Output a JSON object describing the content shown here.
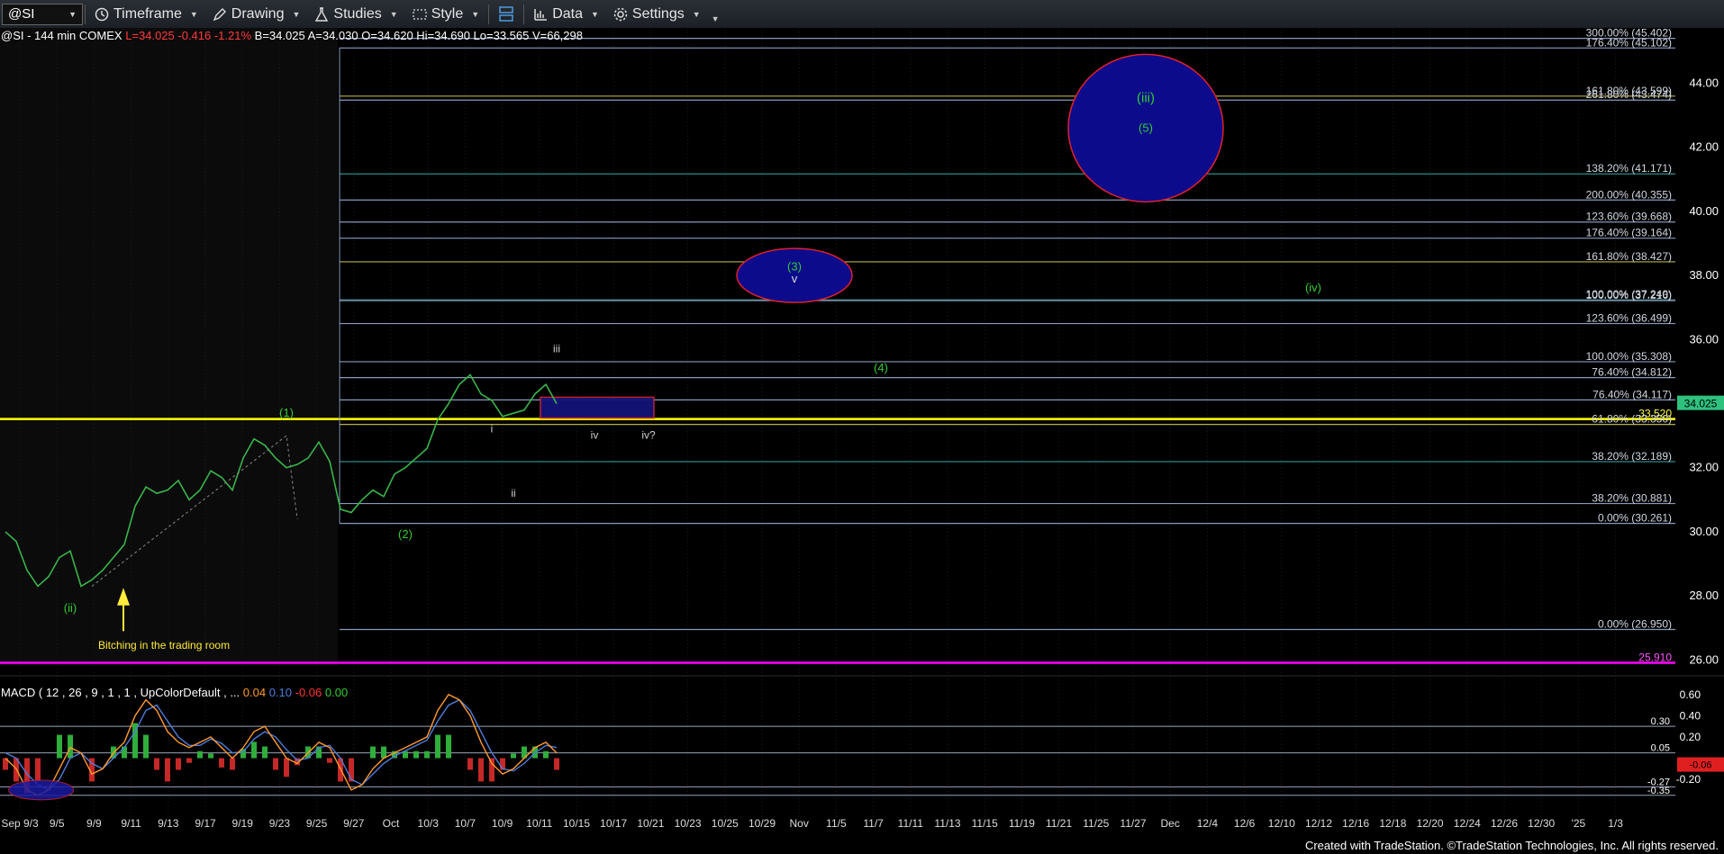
{
  "toolbar": {
    "symbol": "@SI",
    "items": [
      {
        "label": "Timeframe",
        "icon": "clock-icon"
      },
      {
        "label": "Drawing",
        "icon": "pencil-icon"
      },
      {
        "label": "Studies",
        "icon": "flask-icon"
      },
      {
        "label": "Style",
        "icon": "style-icon"
      },
      {
        "label": "",
        "icon": "layout-icon"
      },
      {
        "label": "Data",
        "icon": "bar-chart-icon"
      },
      {
        "label": "Settings",
        "icon": "gear-icon"
      }
    ]
  },
  "header": {
    "prefix": "@SI - 144 min  COMEX ",
    "last": "L=34.025 -0.416 -1.21%",
    "rest": " B=34.025  A=34.030  O=34.620  Hi=34.690  Lo=33.565  V=66,298"
  },
  "footer": "Created with TradeStation. ©TradeStation Technologies, Inc. All rights reserved.",
  "chart_data": {
    "type": "line",
    "title": "@SI - 144 min COMEX",
    "price_axis": {
      "ticks": [
        26.0,
        28.0,
        30.0,
        32.0,
        34.0,
        36.0,
        38.0,
        40.0,
        42.0,
        44.0
      ],
      "range": [
        25.7,
        45.7
      ],
      "last_price": "34.025"
    },
    "x_ticks": [
      "Sep 9/3",
      "9/5",
      "9/9",
      "9/11",
      "9/13",
      "9/17",
      "9/19",
      "9/23",
      "9/25",
      "9/27",
      "Oct",
      "10/3",
      "10/7",
      "10/9",
      "10/11",
      "10/15",
      "10/17",
      "10/21",
      "10/23",
      "10/25",
      "10/29",
      "Nov",
      "11/5",
      "11/7",
      "11/11",
      "11/13",
      "11/15",
      "11/19",
      "11/21",
      "11/25",
      "11/27",
      "Dec",
      "12/4",
      "12/6",
      "12/10",
      "12/12",
      "12/16",
      "12/18",
      "12/20",
      "12/24",
      "12/26",
      "12/30",
      "'25",
      "1/3"
    ],
    "price_path": [
      [
        0,
        30.0
      ],
      [
        1,
        29.7
      ],
      [
        2,
        28.8
      ],
      [
        3,
        28.3
      ],
      [
        4,
        28.6
      ],
      [
        5,
        29.2
      ],
      [
        6,
        29.4
      ],
      [
        7,
        28.3
      ],
      [
        8,
        28.5
      ],
      [
        9,
        28.8
      ],
      [
        10,
        29.2
      ],
      [
        11,
        29.6
      ],
      [
        12,
        30.8
      ],
      [
        13,
        31.4
      ],
      [
        14,
        31.2
      ],
      [
        15,
        31.3
      ],
      [
        16,
        31.6
      ],
      [
        17,
        31.0
      ],
      [
        18,
        31.3
      ],
      [
        19,
        31.9
      ],
      [
        20,
        31.7
      ],
      [
        21,
        31.3
      ],
      [
        22,
        32.3
      ],
      [
        23,
        32.9
      ],
      [
        24,
        32.7
      ],
      [
        25,
        32.3
      ],
      [
        26,
        32.0
      ],
      [
        27,
        32.1
      ],
      [
        28,
        32.3
      ],
      [
        29,
        32.8
      ],
      [
        30,
        32.2
      ],
      [
        31,
        30.7
      ],
      [
        32,
        30.6
      ],
      [
        33,
        31.0
      ],
      [
        34,
        31.3
      ],
      [
        35,
        31.1
      ],
      [
        36,
        31.8
      ],
      [
        37,
        32.0
      ],
      [
        38,
        32.3
      ],
      [
        39,
        32.6
      ],
      [
        40,
        33.5
      ],
      [
        41,
        34.0
      ],
      [
        42,
        34.6
      ],
      [
        43,
        34.9
      ],
      [
        44,
        34.3
      ],
      [
        45,
        34.1
      ],
      [
        46,
        33.6
      ],
      [
        47,
        33.7
      ],
      [
        48,
        33.8
      ],
      [
        49,
        34.3
      ],
      [
        50,
        34.6
      ],
      [
        51,
        34.0
      ]
    ],
    "hlines": [
      {
        "label": "300.00% (45.402)",
        "value": 45.402,
        "color": "#8899bb"
      },
      {
        "label": "176.40% (45.102)",
        "value": 45.102,
        "color": "#8899bb"
      },
      {
        "label": "161.80% (43.599)",
        "value": 43.599,
        "color": "#b5b04a"
      },
      {
        "label": "261.80% (43.474)",
        "value": 43.474,
        "color": "#8899bb"
      },
      {
        "label": "138.20% (41.171)",
        "value": 41.171,
        "color": "#2f8a8a"
      },
      {
        "label": "200.00% (40.355)",
        "value": 40.355,
        "color": "#8899bb"
      },
      {
        "label": "123.60% (39.668)",
        "value": 39.668,
        "color": "#8899bb"
      },
      {
        "label": "176.40% (39.164)",
        "value": 39.164,
        "color": "#8899bb"
      },
      {
        "label": "161.80% (38.427)",
        "value": 38.427,
        "color": "#b5b04a"
      },
      {
        "label": "100.00% (37.240)",
        "value": 37.24,
        "color": "#2f8a8a"
      },
      {
        "label": "100.00% (37.216)",
        "value": 37.216,
        "color": "#8899bb"
      },
      {
        "label": "123.60% (36.499)",
        "value": 36.499,
        "color": "#8899bb"
      },
      {
        "label": "100.00% (35.308)",
        "value": 35.308,
        "color": "#8899bb"
      },
      {
        "label": "76.40% (34.812)",
        "value": 34.812,
        "color": "#8899bb"
      },
      {
        "label": "76.40% (34.117)",
        "value": 34.117,
        "color": "#8899bb"
      },
      {
        "label": "33.520",
        "value": 33.52,
        "color": "#ffff00"
      },
      {
        "label": "61.80% (33.350)",
        "value": 33.35,
        "color": "#b5b04a"
      },
      {
        "label": "38.20% (32.189)",
        "value": 32.189,
        "color": "#2f8a8a"
      },
      {
        "label": "38.20% (30.881)",
        "value": 30.881,
        "color": "#8899bb"
      },
      {
        "label": "0.00% (30.261)",
        "value": 30.261,
        "color": "#8899bb"
      },
      {
        "label": "0.00% (26.950)",
        "value": 26.95,
        "color": "#8899bb"
      },
      {
        "label": "25.910",
        "value": 25.91,
        "color": "#ff00ff"
      }
    ],
    "wave_labels": [
      {
        "text": "(ii)",
        "bar": 6,
        "price": 27.5,
        "color": "#33cc33"
      },
      {
        "text": "(1)",
        "bar": 26,
        "price": 33.6,
        "color": "#33cc33"
      },
      {
        "text": "(2)",
        "bar": 37,
        "price": 29.8,
        "color": "#33cc33"
      },
      {
        "text": "i",
        "bar": 45,
        "price": 33.1,
        "color": "#cfcfcf"
      },
      {
        "text": "ii",
        "bar": 47,
        "price": 31.1,
        "color": "#cfcfcf"
      },
      {
        "text": "iii",
        "bar": 51,
        "price": 35.6,
        "color": "#cfcfcf"
      },
      {
        "text": "iv",
        "bar": 54.5,
        "price": 32.9,
        "color": "#cfcfcf"
      },
      {
        "text": "iv?",
        "bar": 59.5,
        "price": 32.9,
        "color": "#cfcfcf"
      },
      {
        "text": "(4)",
        "bar": 81,
        "price": 35.0,
        "color": "#33cc33"
      },
      {
        "text": "(iv)",
        "bar": 121,
        "price": 37.5,
        "color": "#33cc33"
      }
    ],
    "ellipses": [
      {
        "label_top": "(3)",
        "label_bottom": "v",
        "bar": 73,
        "price": 38.0
      },
      {
        "label_top": "(iii)",
        "label_bottom": "(5)",
        "bar": 105.5,
        "price": 42.6
      }
    ],
    "annotation": "Bitching in the trading room",
    "macd": {
      "label": "MACD ( 12 , 26 , 9 , 1 , 1 , UpColorDefault , ...",
      "values": [
        "0.04",
        "0.10",
        "-0.06",
        "0.00"
      ],
      "value_colors": [
        "#ff9a2e",
        "#4f7ddb",
        "#ff3333",
        "#33cc33"
      ],
      "axis_ticks": [
        "0.60",
        "0.40",
        "0.20",
        "-0.20"
      ],
      "levels": [
        {
          "label": "0.30",
          "value": 0.3
        },
        {
          "label": "0.05",
          "value": 0.05
        },
        {
          "label": "-0.27",
          "value": -0.27
        },
        {
          "label": "-0.35",
          "value": -0.35
        }
      ],
      "current": "-0.06",
      "macd_line": [
        0,
        -0.1,
        -0.3,
        -0.35,
        -0.3,
        -0.1,
        0.1,
        0.05,
        -0.15,
        -0.1,
        0.05,
        0.15,
        0.4,
        0.55,
        0.45,
        0.25,
        0.15,
        0.1,
        0.15,
        0.2,
        0.1,
        0.0,
        0.1,
        0.25,
        0.3,
        0.15,
        0.0,
        -0.05,
        0.05,
        0.15,
        0.1,
        -0.1,
        -0.3,
        -0.25,
        -0.1,
        0.0,
        0.05,
        0.1,
        0.15,
        0.2,
        0.45,
        0.6,
        0.55,
        0.4,
        0.15,
        -0.05,
        -0.15,
        -0.1,
        0.0,
        0.1,
        0.15,
        0.05
      ],
      "signal_line": [
        0.05,
        0.0,
        -0.15,
        -0.25,
        -0.3,
        -0.2,
        0.0,
        0.05,
        -0.05,
        -0.1,
        0.0,
        0.1,
        0.25,
        0.45,
        0.5,
        0.35,
        0.2,
        0.12,
        0.12,
        0.18,
        0.14,
        0.05,
        0.06,
        0.18,
        0.25,
        0.2,
        0.08,
        -0.02,
        0.0,
        0.1,
        0.12,
        0.0,
        -0.2,
        -0.25,
        -0.15,
        -0.05,
        0.02,
        0.07,
        0.12,
        0.17,
        0.35,
        0.5,
        0.55,
        0.45,
        0.25,
        0.05,
        -0.1,
        -0.12,
        -0.05,
        0.05,
        0.12,
        0.1
      ]
    }
  }
}
